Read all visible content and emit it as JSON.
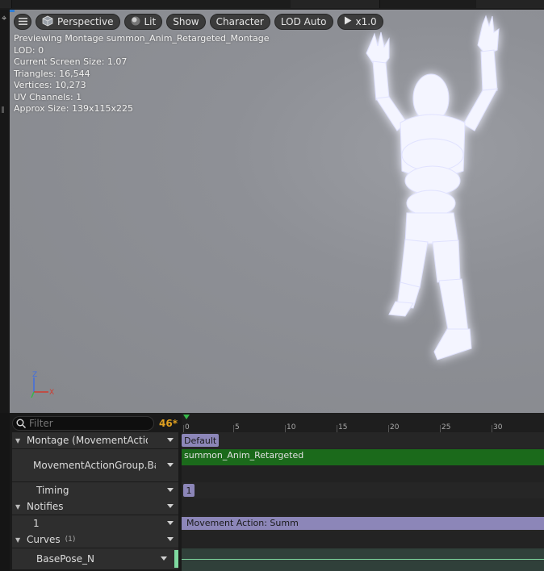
{
  "toolbar": {
    "perspective_label": "Perspective",
    "lit_label": "Lit",
    "show_label": "Show",
    "character_label": "Character",
    "lod_label": "LOD Auto",
    "play_label": "x1.0"
  },
  "info": {
    "line1": "Previewing Montage summon_Anim_Retargeted_Montage",
    "line2": "LOD: 0",
    "line3": "Current Screen Size: 1.07",
    "line4": "Triangles: 16,544",
    "line5": "Vertices: 10,273",
    "line6": "UV Channels: 1",
    "line7": "Approx Size: 139x115x225"
  },
  "axes": {
    "z": "Z",
    "x": "X"
  },
  "tracks": {
    "filter_placeholder": "Filter",
    "count": "46*",
    "montage_label": "Montage (MovementActionGroup",
    "slot_label": "MovementActionGroup.Base",
    "timing_label": "Timing",
    "notifies_label": "Notifies",
    "notify_track_label": "1",
    "curves_label": "Curves",
    "curves_count": "(1)",
    "curve_name": "BasePose_N"
  },
  "timeline": {
    "ticks": [
      "0",
      "5",
      "10",
      "15",
      "20",
      "25",
      "30"
    ],
    "section_label": "Default",
    "anim_label": "summon_Anim_Retargeted",
    "timing_marker": "1",
    "notify_label": "Movement Action: Summ"
  },
  "colors": {
    "anim_track": "#1b6a1b",
    "notify": "#8c86b8",
    "curve_swatch": "#7fd9a0",
    "accent": "#2d7cd6",
    "count": "#e0a020"
  },
  "icons": [
    "menu-icon",
    "cube-icon",
    "sphere-icon",
    "play-icon",
    "search-icon",
    "caret-icon",
    "dropdown-icon"
  ]
}
